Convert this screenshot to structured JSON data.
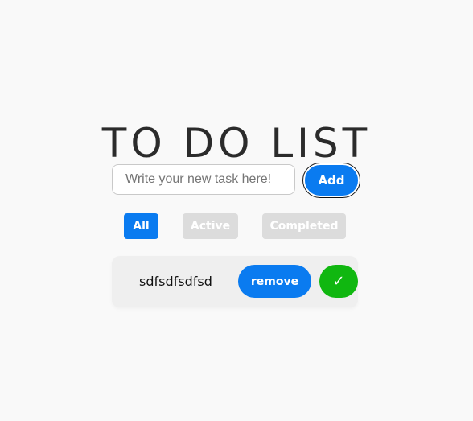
{
  "header": {
    "title": "TO DO LIST"
  },
  "new_task": {
    "placeholder": "Write your new task here!",
    "value": "",
    "add_label": "Add"
  },
  "filters": [
    {
      "label": "All",
      "selected": true
    },
    {
      "label": "Active",
      "selected": false
    },
    {
      "label": "Completed",
      "selected": false
    }
  ],
  "tasks": [
    {
      "text": "sdfsdfsdfsd",
      "remove_label": "remove",
      "complete_icon": "check-icon",
      "complete_glyph": "✓"
    }
  ],
  "colors": {
    "accent": "#0a7bf0",
    "success": "#10b710",
    "inactive_filter": "#dcdcdc",
    "background": "#f9f9f9",
    "card": "#efefef"
  }
}
